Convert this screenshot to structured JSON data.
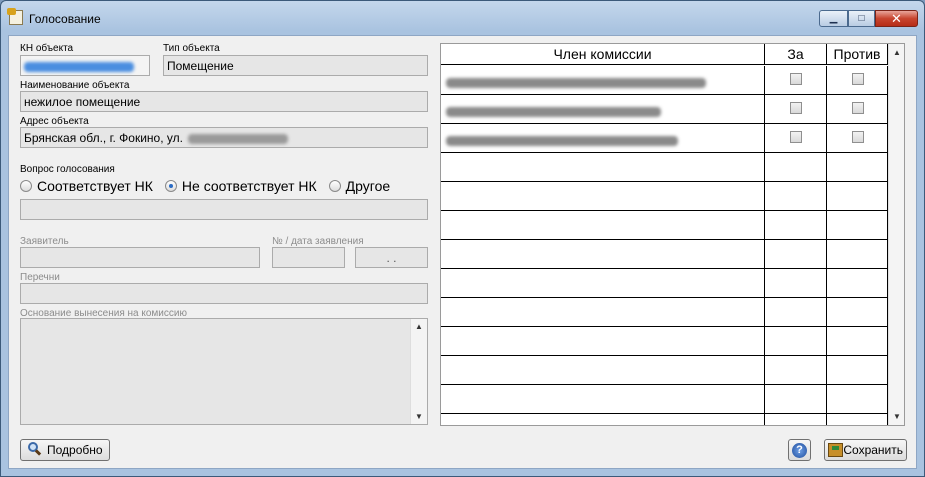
{
  "window": {
    "title": "Голосование",
    "minimize": "▁",
    "maximize": "□",
    "close": "✕"
  },
  "form": {
    "kn_label": "КН объекта",
    "kn_value": "",
    "type_label": "Тип объекта",
    "type_value": "Помещение",
    "name_label": "Наименование объекта",
    "name_value": "нежилое помещение",
    "address_label": "Адрес объекта",
    "address_value": "Брянская обл., г. Фокино, ул.",
    "question_label": "Вопрос голосования",
    "radio_options": [
      "Соответствует НК",
      "Не соответствует НК",
      "Другое"
    ],
    "radio_selected": 1,
    "applicant_label": "Заявитель",
    "appdate_label": "№ / дата заявления",
    "date_value": " .  .",
    "lists_label": "Перечни",
    "basis_label": "Основание вынесения на комиссию"
  },
  "grid": {
    "columns": [
      "Член комиссии",
      "За",
      "Против"
    ],
    "rows": [
      {
        "za": false,
        "protiv": false
      },
      {
        "za": false,
        "protiv": false
      },
      {
        "za": false,
        "protiv": false
      }
    ],
    "empty_rows": 9
  },
  "buttons": {
    "details": "Подробно",
    "help": "?",
    "save": "Сохранить"
  },
  "scroll": {
    "up": "▲",
    "down": "▼"
  }
}
